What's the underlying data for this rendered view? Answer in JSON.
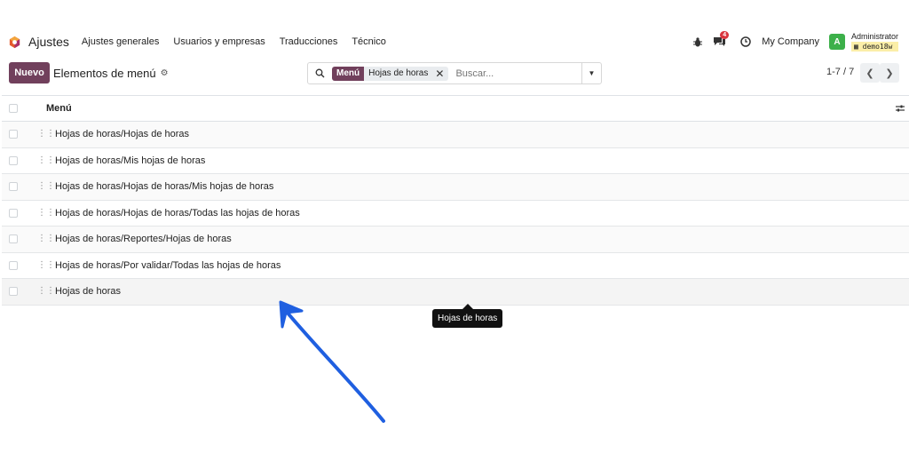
{
  "app": {
    "title": "Ajustes"
  },
  "menu": [
    "Ajustes generales",
    "Usuarios y empresas",
    "Traducciones",
    "Técnico"
  ],
  "systray": {
    "messages_count": "4",
    "company": "My Company",
    "avatar_letter": "A",
    "user": "Administrator",
    "database": "demo18w"
  },
  "control": {
    "new_button": "Nuevo",
    "title": "Elementos de menú"
  },
  "search": {
    "facet_label": "Menú",
    "facet_value": "Hojas de horas",
    "placeholder": "Buscar..."
  },
  "pager": {
    "text": "1-7 / 7"
  },
  "list": {
    "column": "Menú",
    "rows": [
      "Hojas de horas/Hojas de horas",
      "Hojas de horas/Mis hojas de horas",
      "Hojas de horas/Hojas de horas/Mis hojas de horas",
      "Hojas de horas/Hojas de horas/Todas las hojas de horas",
      "Hojas de horas/Reportes/Hojas de horas",
      "Hojas de horas/Por validar/Todas las hojas de horas",
      "Hojas de horas"
    ]
  },
  "tooltip": {
    "text": "Hojas de horas"
  },
  "colors": {
    "brand": "#71405c",
    "badge": "#d9363e",
    "avatar": "#3cb04a",
    "annotation": "#1f5fe0"
  }
}
